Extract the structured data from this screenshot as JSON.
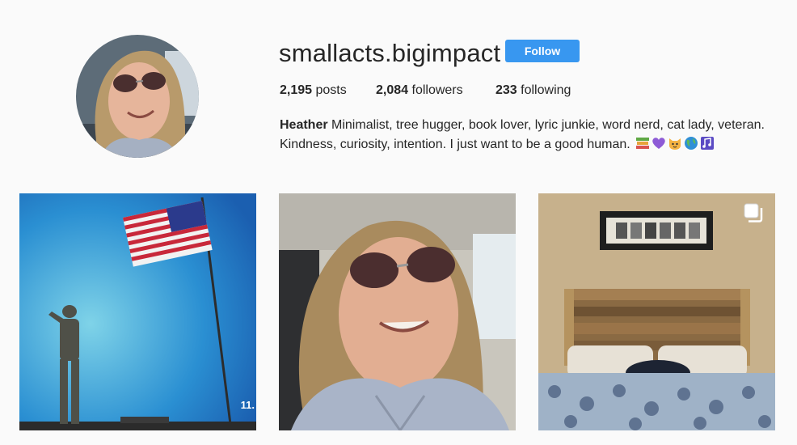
{
  "profile": {
    "username": "smallacts.bigimpact",
    "follow_label": "Follow",
    "avatar_icon": "profile-photo"
  },
  "stats": {
    "posts_count": "2,195",
    "posts_label": "posts",
    "followers_count": "2,084",
    "followers_label": "followers",
    "following_count": "233",
    "following_label": "following"
  },
  "bio": {
    "name": "Heather",
    "line1": " Minimalist, tree hugger, book lover, lyric junkie, word nerd, cat lady, veteran.",
    "line2": "Kindness, curiosity, intention. I just want to be a good human. ",
    "emojis": [
      "books-icon",
      "purple-heart-icon",
      "cat-face-icon",
      "globe-icon",
      "music-notes-icon"
    ]
  },
  "posts": [
    {
      "type": "image",
      "icon": "flag-salute-photo",
      "corner_text": "11."
    },
    {
      "type": "image",
      "icon": "selfie-photo"
    },
    {
      "type": "carousel",
      "icon": "bedroom-photo",
      "badge_icon": "carousel-icon"
    }
  ],
  "colors": {
    "accent": "#3897f0",
    "background": "#fafafa",
    "text": "#262626"
  }
}
